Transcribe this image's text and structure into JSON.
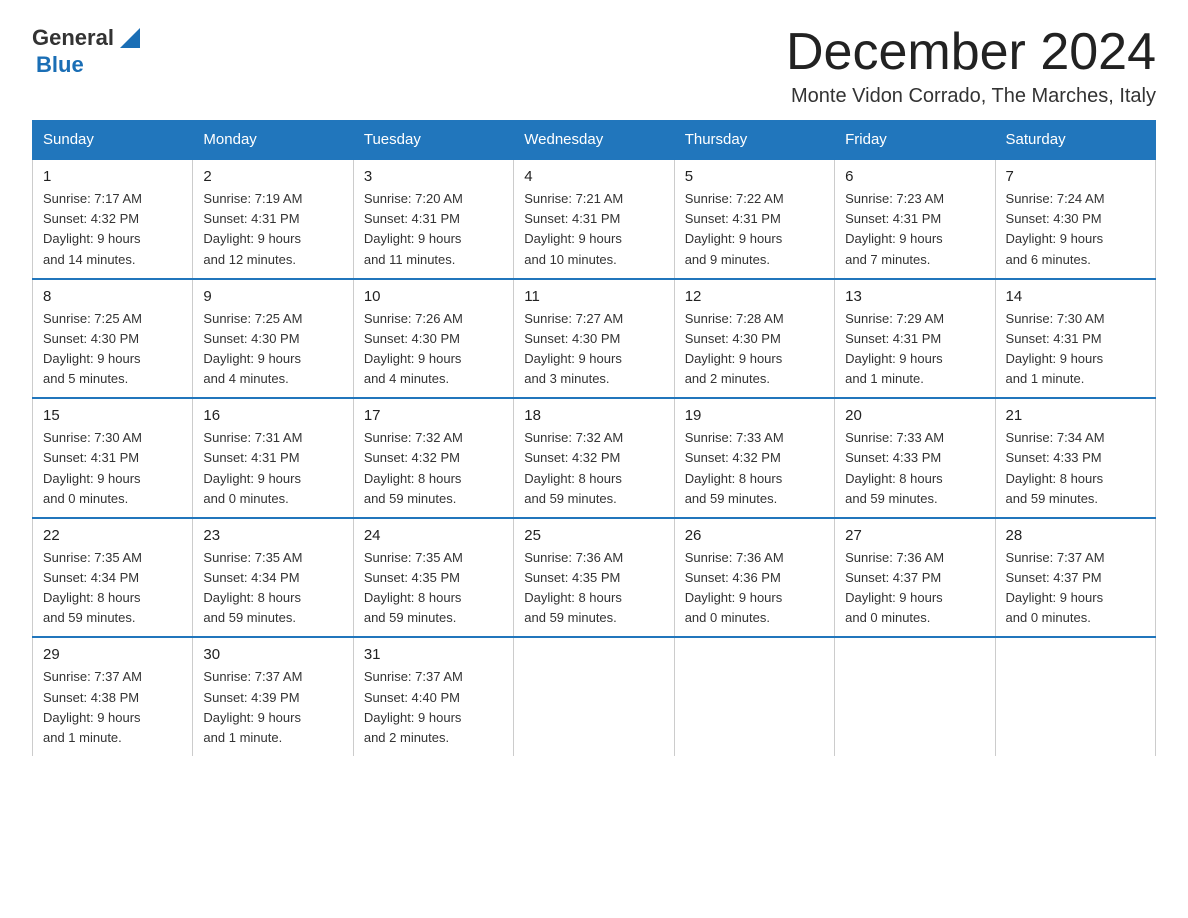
{
  "logo": {
    "line1": "General",
    "triangle_color": "#1a6eb5",
    "line2": "Blue"
  },
  "title": "December 2024",
  "subtitle": "Monte Vidon Corrado, The Marches, Italy",
  "days_of_week": [
    "Sunday",
    "Monday",
    "Tuesday",
    "Wednesday",
    "Thursday",
    "Friday",
    "Saturday"
  ],
  "weeks": [
    [
      {
        "day": "1",
        "info": "Sunrise: 7:17 AM\nSunset: 4:32 PM\nDaylight: 9 hours\nand 14 minutes."
      },
      {
        "day": "2",
        "info": "Sunrise: 7:19 AM\nSunset: 4:31 PM\nDaylight: 9 hours\nand 12 minutes."
      },
      {
        "day": "3",
        "info": "Sunrise: 7:20 AM\nSunset: 4:31 PM\nDaylight: 9 hours\nand 11 minutes."
      },
      {
        "day": "4",
        "info": "Sunrise: 7:21 AM\nSunset: 4:31 PM\nDaylight: 9 hours\nand 10 minutes."
      },
      {
        "day": "5",
        "info": "Sunrise: 7:22 AM\nSunset: 4:31 PM\nDaylight: 9 hours\nand 9 minutes."
      },
      {
        "day": "6",
        "info": "Sunrise: 7:23 AM\nSunset: 4:31 PM\nDaylight: 9 hours\nand 7 minutes."
      },
      {
        "day": "7",
        "info": "Sunrise: 7:24 AM\nSunset: 4:30 PM\nDaylight: 9 hours\nand 6 minutes."
      }
    ],
    [
      {
        "day": "8",
        "info": "Sunrise: 7:25 AM\nSunset: 4:30 PM\nDaylight: 9 hours\nand 5 minutes."
      },
      {
        "day": "9",
        "info": "Sunrise: 7:25 AM\nSunset: 4:30 PM\nDaylight: 9 hours\nand 4 minutes."
      },
      {
        "day": "10",
        "info": "Sunrise: 7:26 AM\nSunset: 4:30 PM\nDaylight: 9 hours\nand 4 minutes."
      },
      {
        "day": "11",
        "info": "Sunrise: 7:27 AM\nSunset: 4:30 PM\nDaylight: 9 hours\nand 3 minutes."
      },
      {
        "day": "12",
        "info": "Sunrise: 7:28 AM\nSunset: 4:30 PM\nDaylight: 9 hours\nand 2 minutes."
      },
      {
        "day": "13",
        "info": "Sunrise: 7:29 AM\nSunset: 4:31 PM\nDaylight: 9 hours\nand 1 minute."
      },
      {
        "day": "14",
        "info": "Sunrise: 7:30 AM\nSunset: 4:31 PM\nDaylight: 9 hours\nand 1 minute."
      }
    ],
    [
      {
        "day": "15",
        "info": "Sunrise: 7:30 AM\nSunset: 4:31 PM\nDaylight: 9 hours\nand 0 minutes."
      },
      {
        "day": "16",
        "info": "Sunrise: 7:31 AM\nSunset: 4:31 PM\nDaylight: 9 hours\nand 0 minutes."
      },
      {
        "day": "17",
        "info": "Sunrise: 7:32 AM\nSunset: 4:32 PM\nDaylight: 8 hours\nand 59 minutes."
      },
      {
        "day": "18",
        "info": "Sunrise: 7:32 AM\nSunset: 4:32 PM\nDaylight: 8 hours\nand 59 minutes."
      },
      {
        "day": "19",
        "info": "Sunrise: 7:33 AM\nSunset: 4:32 PM\nDaylight: 8 hours\nand 59 minutes."
      },
      {
        "day": "20",
        "info": "Sunrise: 7:33 AM\nSunset: 4:33 PM\nDaylight: 8 hours\nand 59 minutes."
      },
      {
        "day": "21",
        "info": "Sunrise: 7:34 AM\nSunset: 4:33 PM\nDaylight: 8 hours\nand 59 minutes."
      }
    ],
    [
      {
        "day": "22",
        "info": "Sunrise: 7:35 AM\nSunset: 4:34 PM\nDaylight: 8 hours\nand 59 minutes."
      },
      {
        "day": "23",
        "info": "Sunrise: 7:35 AM\nSunset: 4:34 PM\nDaylight: 8 hours\nand 59 minutes."
      },
      {
        "day": "24",
        "info": "Sunrise: 7:35 AM\nSunset: 4:35 PM\nDaylight: 8 hours\nand 59 minutes."
      },
      {
        "day": "25",
        "info": "Sunrise: 7:36 AM\nSunset: 4:35 PM\nDaylight: 8 hours\nand 59 minutes."
      },
      {
        "day": "26",
        "info": "Sunrise: 7:36 AM\nSunset: 4:36 PM\nDaylight: 9 hours\nand 0 minutes."
      },
      {
        "day": "27",
        "info": "Sunrise: 7:36 AM\nSunset: 4:37 PM\nDaylight: 9 hours\nand 0 minutes."
      },
      {
        "day": "28",
        "info": "Sunrise: 7:37 AM\nSunset: 4:37 PM\nDaylight: 9 hours\nand 0 minutes."
      }
    ],
    [
      {
        "day": "29",
        "info": "Sunrise: 7:37 AM\nSunset: 4:38 PM\nDaylight: 9 hours\nand 1 minute."
      },
      {
        "day": "30",
        "info": "Sunrise: 7:37 AM\nSunset: 4:39 PM\nDaylight: 9 hours\nand 1 minute."
      },
      {
        "day": "31",
        "info": "Sunrise: 7:37 AM\nSunset: 4:40 PM\nDaylight: 9 hours\nand 2 minutes."
      },
      {
        "day": "",
        "info": ""
      },
      {
        "day": "",
        "info": ""
      },
      {
        "day": "",
        "info": ""
      },
      {
        "day": "",
        "info": ""
      }
    ]
  ]
}
